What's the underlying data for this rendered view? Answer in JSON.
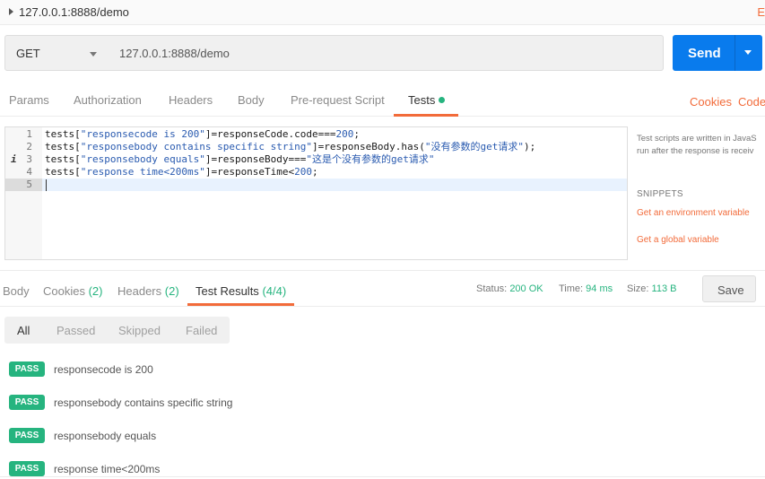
{
  "address_bar": {
    "url": "127.0.0.1:8888/demo",
    "right_text": "E"
  },
  "request": {
    "method": "GET",
    "url": "127.0.0.1:8888/demo",
    "send_label": "Send"
  },
  "request_tabs": [
    "Params",
    "Authorization",
    "Headers",
    "Body",
    "Pre-request Script",
    "Tests"
  ],
  "request_links": {
    "cookies": "Cookies",
    "code": "Code"
  },
  "editor": {
    "lines": [
      {
        "num": "1",
        "parts": [
          [
            "",
            "tests["
          ],
          [
            "s",
            "\"responsecode is 200\""
          ],
          [
            "",
            "]=responseCode.code==="
          ],
          [
            "s",
            "200"
          ],
          [
            "",
            ";"
          ]
        ]
      },
      {
        "num": "2",
        "parts": [
          [
            "",
            "tests["
          ],
          [
            "s",
            "\"responsebody contains specific string\""
          ],
          [
            "",
            "]=responseBody.has("
          ],
          [
            "s",
            "\"没有参数的get请求\""
          ],
          [
            "",
            ");"
          ]
        ]
      },
      {
        "num": "3",
        "info": "i",
        "parts": [
          [
            "",
            "tests["
          ],
          [
            "s",
            "\"responsebody equals\""
          ],
          [
            "",
            "]=responseBody==="
          ],
          [
            "s",
            "\"这是个没有参数的get请求\""
          ]
        ]
      },
      {
        "num": "4",
        "parts": [
          [
            "",
            "tests["
          ],
          [
            "s",
            "\"response time<200ms\""
          ],
          [
            "",
            "]=responseTime<"
          ],
          [
            "s",
            "200"
          ],
          [
            "",
            ";"
          ]
        ]
      },
      {
        "num": "5",
        "parts": []
      }
    ]
  },
  "side_panel": {
    "description_line1": "Test scripts are written in JavaS",
    "description_line2": "run after the response is receiv",
    "snippets_title": "SNIPPETS",
    "snippets": [
      "Get an environment variable",
      "Get a global variable"
    ]
  },
  "response_tabs": {
    "body": "Body",
    "cookies": "Cookies",
    "cookies_count": "(2)",
    "headers": "Headers",
    "headers_count": "(2)",
    "test_results": "Test Results",
    "test_results_count": "(4/4)"
  },
  "status": {
    "status_label": "Status:",
    "status_value": "200 OK",
    "time_label": "Time:",
    "time_value": "94 ms",
    "size_label": "Size:",
    "size_value": "113 B"
  },
  "save_label": "Save",
  "filters": [
    "All",
    "Passed",
    "Skipped",
    "Failed"
  ],
  "results": [
    {
      "badge": "PASS",
      "text": "responsecode is 200"
    },
    {
      "badge": "PASS",
      "text": "responsebody contains specific string"
    },
    {
      "badge": "PASS",
      "text": "responsebody equals"
    },
    {
      "badge": "PASS",
      "text": "response time<200ms"
    }
  ],
  "colors": {
    "accent": "#f26b3a",
    "send": "#097bed",
    "pass": "#26b47f"
  }
}
